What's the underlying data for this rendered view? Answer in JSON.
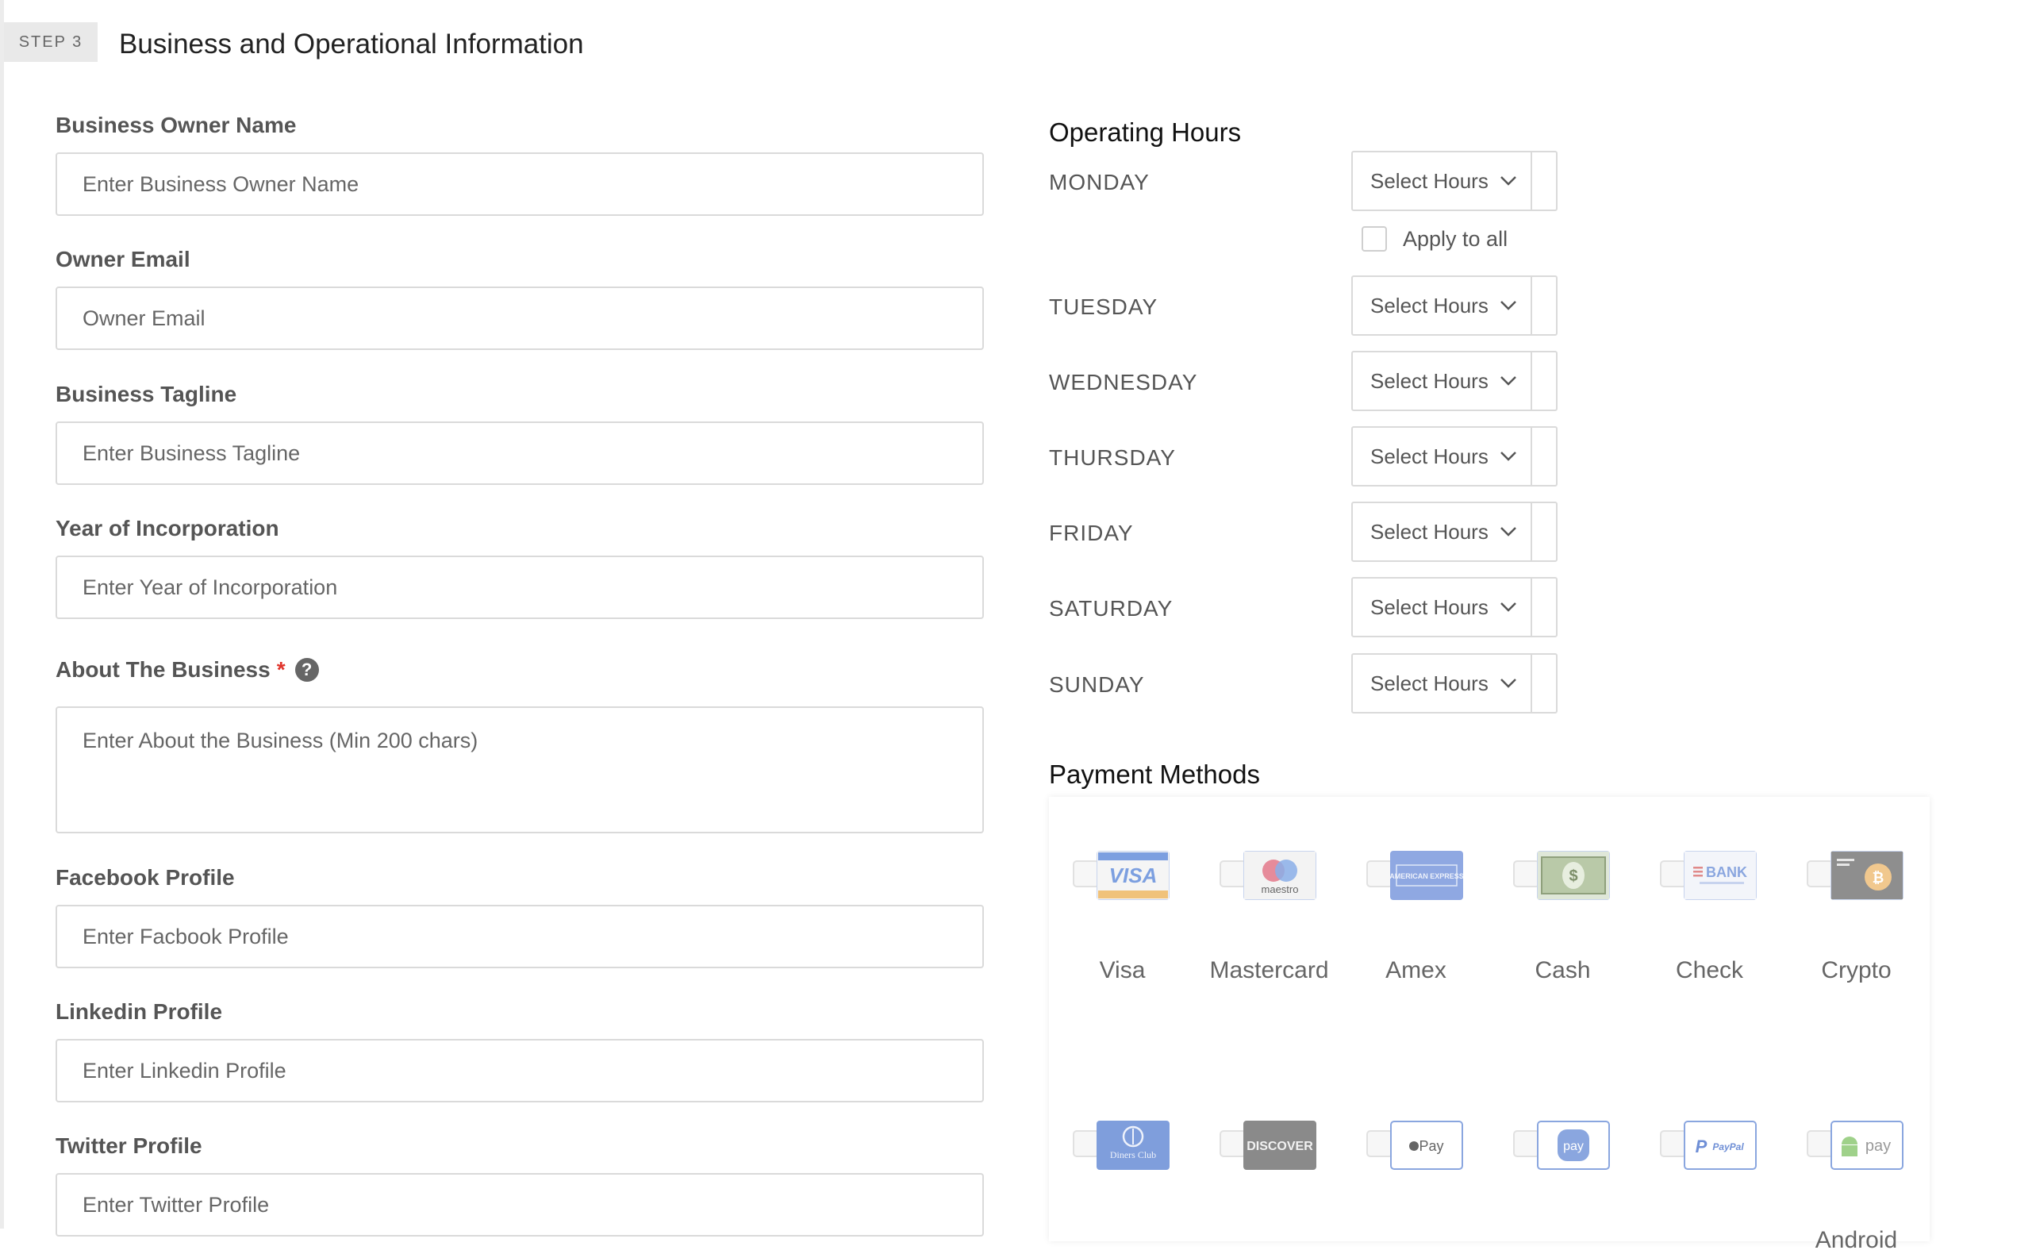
{
  "step": {
    "badge": "STEP 3",
    "title": "Business and Operational Information"
  },
  "form": {
    "fields": [
      {
        "label": "Business Owner Name",
        "placeholder": "Enter Business Owner Name"
      },
      {
        "label": "Owner Email",
        "placeholder": "Owner Email"
      },
      {
        "label": "Business Tagline",
        "placeholder": "Enter Business Tagline"
      },
      {
        "label": "Year of Incorporation",
        "placeholder": "Enter Year of Incorporation"
      },
      {
        "label": "About The Business",
        "required_mark": "*",
        "help_icon": "?",
        "placeholder": "Enter About the Business (Min 200 chars)"
      },
      {
        "label": "Facebook Profile",
        "placeholder": "Enter Facbook Profile"
      },
      {
        "label": "Linkedin Profile",
        "placeholder": "Enter Linkedin Profile"
      },
      {
        "label": "Twitter Profile",
        "placeholder": "Enter Twitter Profile"
      }
    ]
  },
  "hours": {
    "heading": "Operating Hours",
    "apply_all_label": "Apply to all",
    "days": [
      {
        "name": "MONDAY",
        "value": "Select Hours"
      },
      {
        "name": "TUESDAY",
        "value": "Select Hours"
      },
      {
        "name": "WEDNESDAY",
        "value": "Select Hours"
      },
      {
        "name": "THURSDAY",
        "value": "Select Hours"
      },
      {
        "name": "FRIDAY",
        "value": "Select Hours"
      },
      {
        "name": "SATURDAY",
        "value": "Select Hours"
      },
      {
        "name": "SUNDAY",
        "value": "Select Hours"
      }
    ]
  },
  "payments": {
    "heading": "Payment Methods",
    "methods": [
      {
        "name": "Visa",
        "logo_text": "VISA"
      },
      {
        "name": "Mastercard",
        "logo_text": "maestro"
      },
      {
        "name": "Amex",
        "logo_text": "AMERICAN EXPRESS"
      },
      {
        "name": "Cash",
        "logo_text": ""
      },
      {
        "name": "Check",
        "logo_text": "BANK"
      },
      {
        "name": "Crypto",
        "logo_text": "₿"
      },
      {
        "name": "",
        "logo_text": "Diners Club"
      },
      {
        "name": "",
        "logo_text": "DISCOVER"
      },
      {
        "name": "",
        "logo_text": "Pay"
      },
      {
        "name": "",
        "logo_text": "pay"
      },
      {
        "name": "",
        "logo_text": "PayPal"
      },
      {
        "name": "Android",
        "logo_text": "pay"
      }
    ]
  },
  "colors": {
    "accent_required": "#e0342b",
    "logo_blue": "#7aa0e6",
    "logo_gray": "#8e8e8e"
  }
}
